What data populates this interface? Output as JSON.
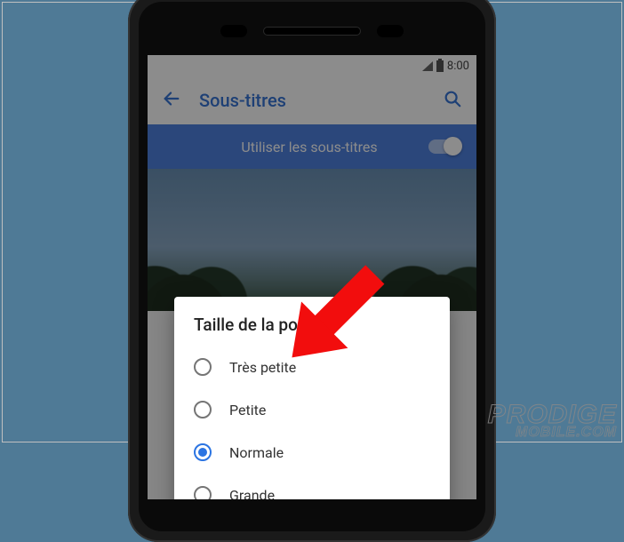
{
  "statusbar": {
    "time": "8:00"
  },
  "appbar": {
    "title": "Sous-titres"
  },
  "toggle": {
    "label": "Utiliser les sous-titres",
    "on": true
  },
  "dialog": {
    "title": "Taille de la police",
    "options": [
      {
        "label": "Très petite",
        "selected": false
      },
      {
        "label": "Petite",
        "selected": false
      },
      {
        "label": "Normale",
        "selected": true
      },
      {
        "label": "Grande",
        "selected": false
      }
    ]
  },
  "watermark": {
    "line1": "PRODIGE",
    "line2": "MOBILE.COM"
  }
}
